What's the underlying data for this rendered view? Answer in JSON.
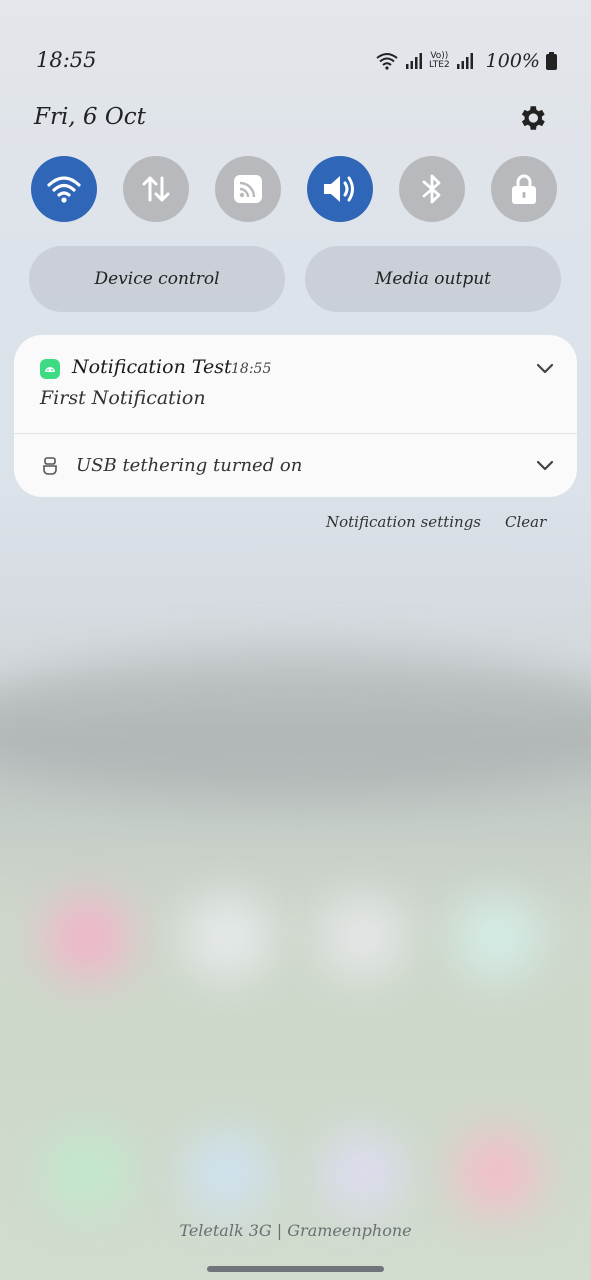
{
  "status_bar": {
    "time": "18:55",
    "network_top": "Vo))",
    "network_bottom": "LTE2",
    "battery": "100%"
  },
  "header": {
    "date": "Fri, 6 Oct",
    "settings_icon": "gear-icon"
  },
  "quick_settings": {
    "tiles": [
      {
        "name": "Wi-Fi",
        "icon": "wifi-icon",
        "state": "on"
      },
      {
        "name": "Mobile data",
        "icon": "mobile-data-icon",
        "state": "off"
      },
      {
        "name": "Cast",
        "icon": "cast-icon",
        "state": "off"
      },
      {
        "name": "Sound",
        "icon": "sound-icon",
        "state": "on"
      },
      {
        "name": "Bluetooth",
        "icon": "bluetooth-icon",
        "state": "off"
      },
      {
        "name": "Lock",
        "icon": "lock-icon",
        "state": "off"
      }
    ],
    "device_control_label": "Device control",
    "media_output_label": "Media output"
  },
  "notifications": [
    {
      "app": "Notification Test",
      "time": "18:55",
      "body": "First Notification",
      "icon": "android-icon"
    },
    {
      "text": "USB tethering turned on",
      "icon": "usb-icon"
    }
  ],
  "actions": {
    "settings_label": "Notification settings",
    "clear_label": "Clear"
  },
  "carrier": "Teletalk 3G | Grameenphone",
  "colors": {
    "tile_on": "#2f66b7",
    "tile_off": "#b7b9bd",
    "android_green": "#3ddc84"
  }
}
